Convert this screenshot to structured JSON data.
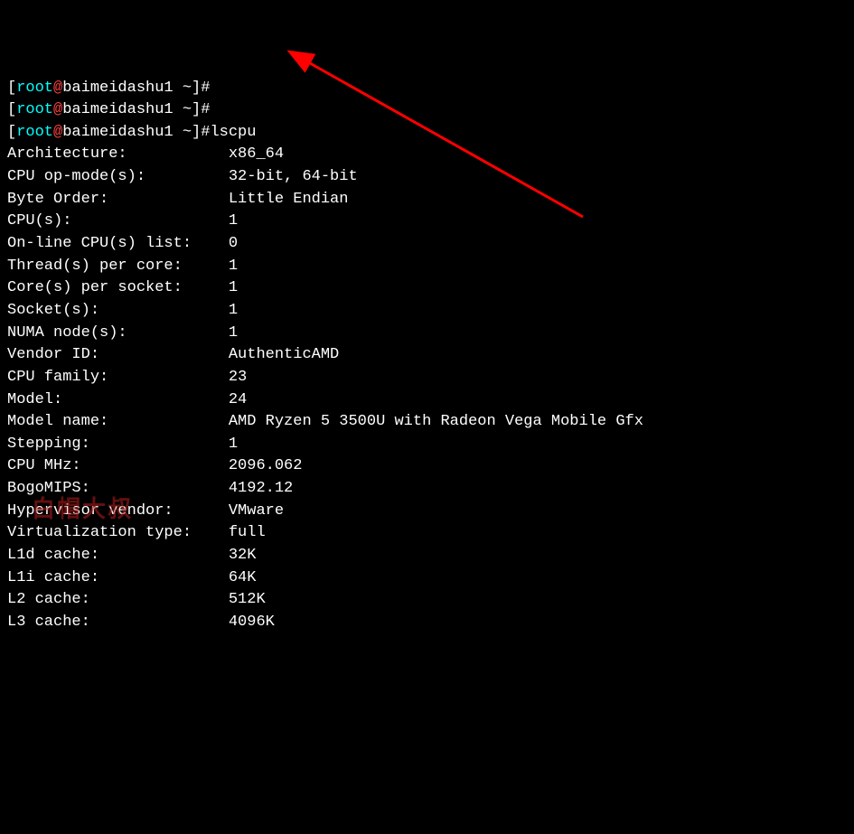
{
  "prompts": [
    {
      "user": "root",
      "at": "@",
      "host": "baimeidashu1",
      "path": "~",
      "cmd": ""
    },
    {
      "user": "root",
      "at": "@",
      "host": "baimeidashu1",
      "path": "~",
      "cmd": ""
    },
    {
      "user": "root",
      "at": "@",
      "host": "baimeidashu1",
      "path": "~",
      "cmd": "lscpu"
    }
  ],
  "output": [
    {
      "key": "Architecture:",
      "value": "x86_64"
    },
    {
      "key": "CPU op-mode(s):",
      "value": "32-bit, 64-bit"
    },
    {
      "key": "Byte Order:",
      "value": "Little Endian"
    },
    {
      "key": "CPU(s):",
      "value": "1"
    },
    {
      "key": "On-line CPU(s) list:",
      "value": "0"
    },
    {
      "key": "Thread(s) per core:",
      "value": "1"
    },
    {
      "key": "Core(s) per socket:",
      "value": "1"
    },
    {
      "key": "Socket(s):",
      "value": "1"
    },
    {
      "key": "NUMA node(s):",
      "value": "1"
    },
    {
      "key": "Vendor ID:",
      "value": "AuthenticAMD"
    },
    {
      "key": "CPU family:",
      "value": "23"
    },
    {
      "key": "Model:",
      "value": "24"
    },
    {
      "key": "Model name:",
      "value": "AMD Ryzen 5 3500U with Radeon Vega Mobile Gfx"
    },
    {
      "key": "Stepping:",
      "value": "1"
    },
    {
      "key": "CPU MHz:",
      "value": "2096.062"
    },
    {
      "key": "BogoMIPS:",
      "value": "4192.12"
    },
    {
      "key": "Hypervisor vendor:",
      "value": "VMware"
    },
    {
      "key": "Virtualization type:",
      "value": "full"
    },
    {
      "key": "L1d cache:",
      "value": "32K"
    },
    {
      "key": "L1i cache:",
      "value": "64K"
    },
    {
      "key": "L2 cache:",
      "value": "512K"
    },
    {
      "key": "L3 cache:",
      "value": "4096K"
    }
  ],
  "watermark": "白帽大叔",
  "topline": "[root@baimeidashu1 ~]#"
}
